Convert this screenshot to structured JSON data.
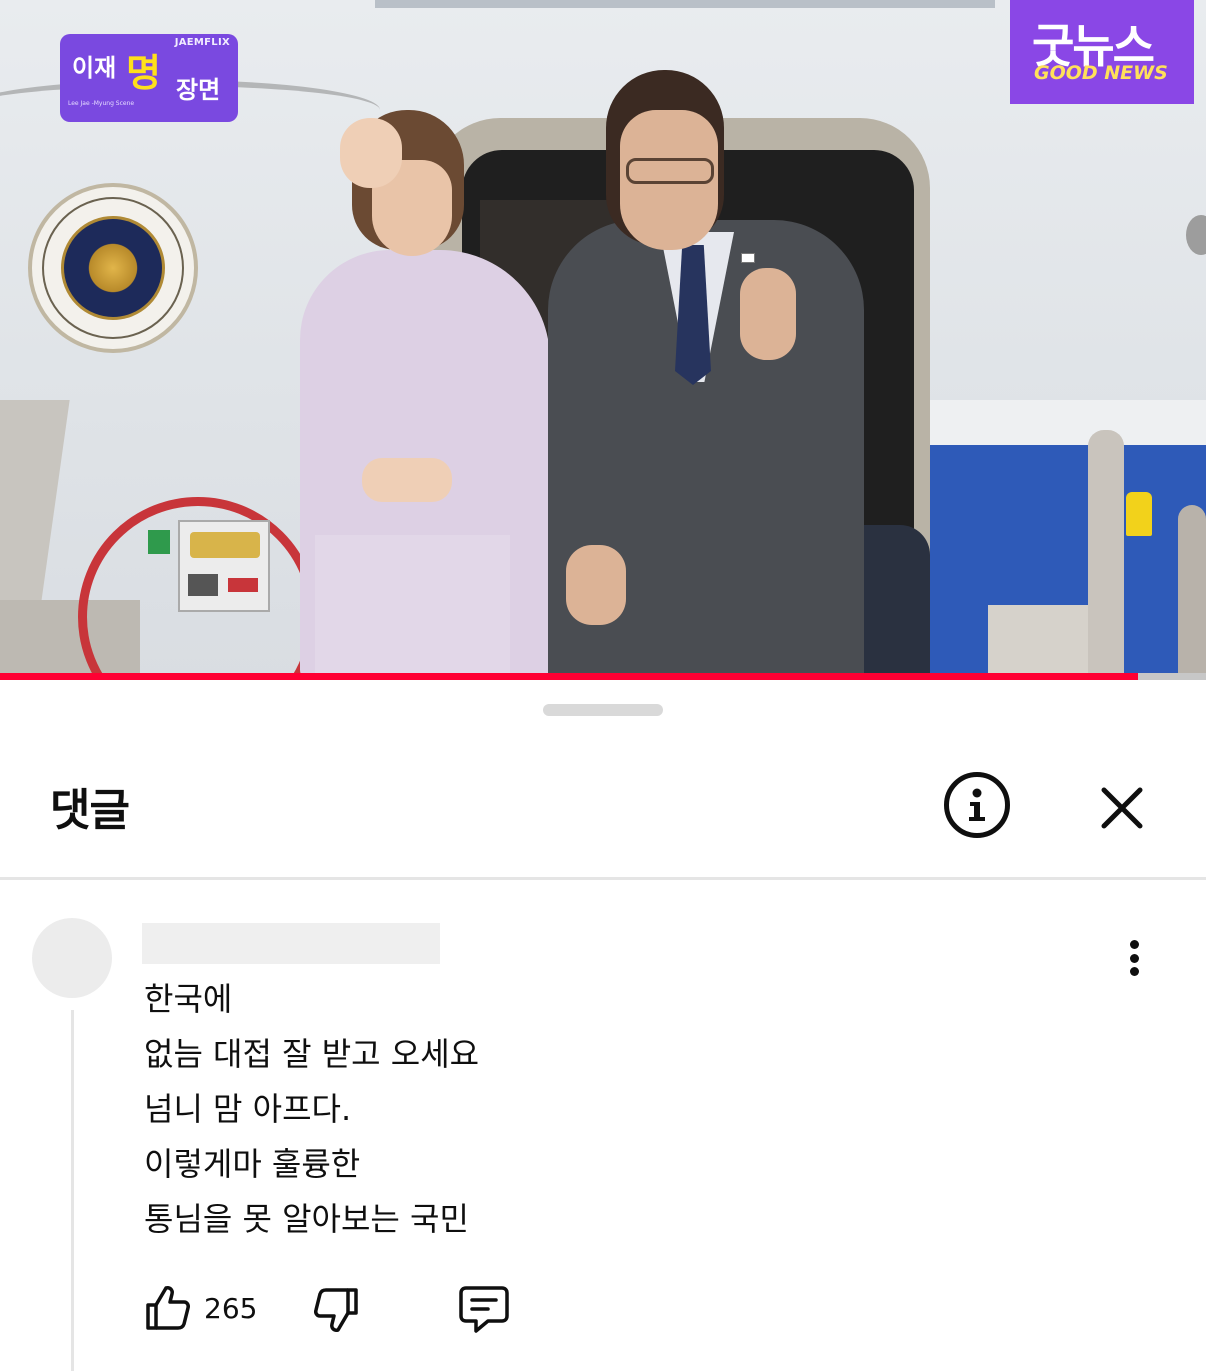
{
  "video": {
    "seal_text": "대한민국대통령 · THE PRESIDENT OF THE REPUBLIC OF KOREA",
    "logo_left": {
      "brand": "JAEMFLIX",
      "part1": "이재",
      "part2": "명",
      "part3": "장면",
      "subtitle": "Lee Jae -Myung Scene"
    },
    "logo_right": {
      "korean": "굿뉴스",
      "english": "GOOD NEWS"
    },
    "progress_fraction": 0.944,
    "colors": {
      "progress": "#ff0033",
      "logo_bg": "#7a49e0",
      "logo_accent": "#ffe01b"
    }
  },
  "comments_sheet": {
    "title": "댓글",
    "info_icon": "info-icon",
    "close_icon": "close-icon",
    "comment": {
      "author_hidden": true,
      "lines": [
        "한국에",
        "없늠 대접 잘 받고 오세요",
        "넘니 맘 아프다.",
        "이렇게마 훌륭한",
        "통님을 못 알아보는 국민"
      ],
      "like_count": "265",
      "icons": [
        "thumbs-up-icon",
        "thumbs-down-icon",
        "reply-icon",
        "more-vertical-icon"
      ]
    }
  }
}
